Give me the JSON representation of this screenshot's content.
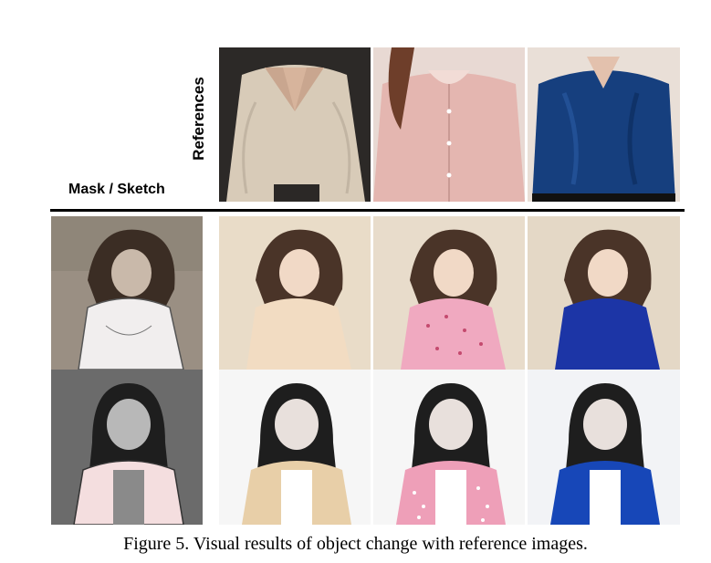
{
  "labels": {
    "references": "References",
    "mask_sketch": "Mask / Sketch"
  },
  "caption": "Figure 5. Visual results of object change with reference images.",
  "references": [
    {
      "garment": "cream knit v-neck sweater",
      "color": "#d8cbb8"
    },
    {
      "garment": "pink patterned blouse",
      "color": "#e4b6b0"
    },
    {
      "garment": "navy satin shirt",
      "color": "#163f7e"
    }
  ],
  "rows": [
    {
      "input": {
        "kind": "mask/sketch",
        "garment_color": "#f1eeee",
        "bg": "#9a8f83"
      },
      "results": [
        {
          "garment_color": "#f2dcc2",
          "bg": "#e9dcc8"
        },
        {
          "garment_color": "#f0a9c0",
          "bg": "#e8dccb"
        },
        {
          "garment_color": "#1c35a6",
          "bg": "#e4d8c6"
        }
      ]
    },
    {
      "input": {
        "kind": "mask/sketch",
        "garment_color": "#f4dedf",
        "bg": "#6b6b6b"
      },
      "results": [
        {
          "garment_color": "#e8cfa8",
          "bg": "#f6f6f6"
        },
        {
          "garment_color": "#ee9fb8",
          "bg": "#f6f6f6"
        },
        {
          "garment_color": "#1747b8",
          "bg": "#f2f3f6"
        }
      ]
    }
  ]
}
